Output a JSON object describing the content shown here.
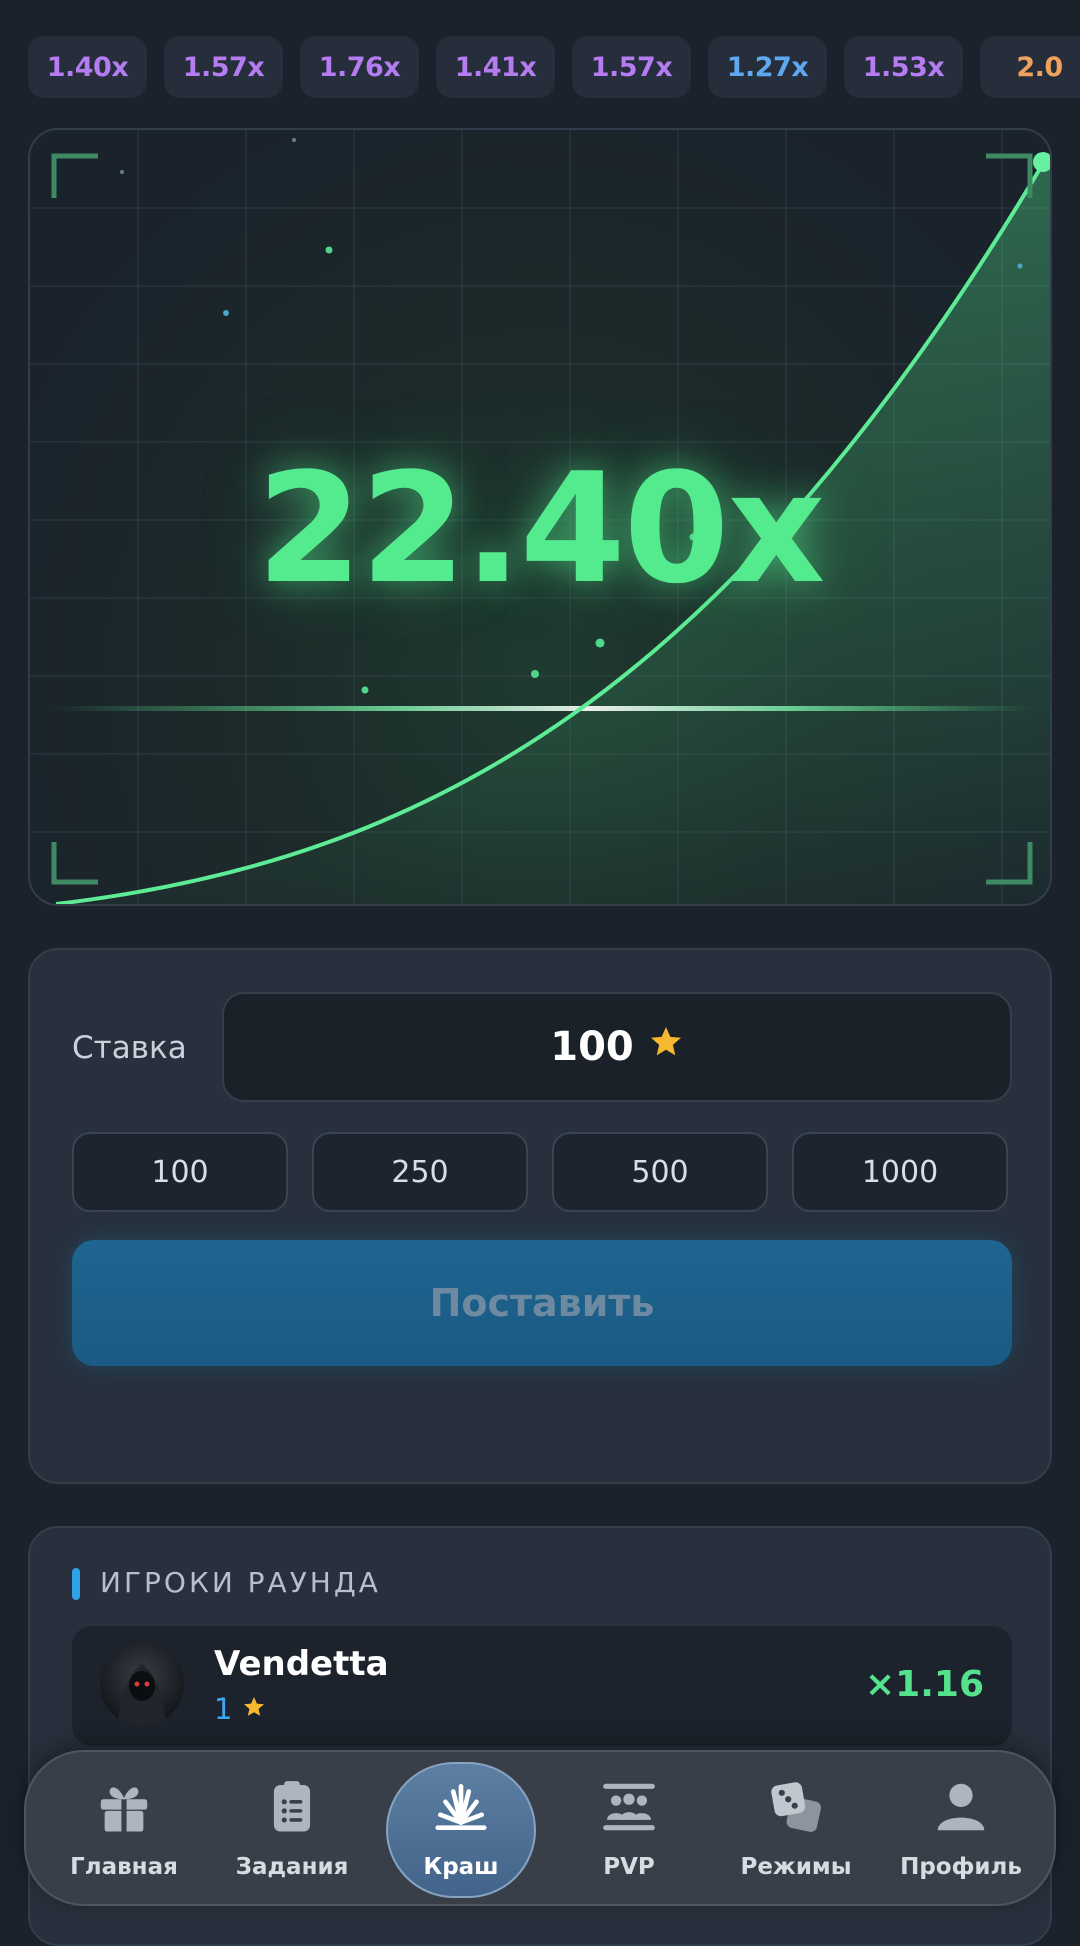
{
  "history": [
    {
      "label": "1.40x",
      "color": "#b57bf1"
    },
    {
      "label": "1.57x",
      "color": "#b57bf1"
    },
    {
      "label": "1.76x",
      "color": "#b57bf1"
    },
    {
      "label": "1.41x",
      "color": "#b57bf1"
    },
    {
      "label": "1.57x",
      "color": "#b57bf1"
    },
    {
      "label": "1.27x",
      "color": "#5fa8f0"
    },
    {
      "label": "1.53x",
      "color": "#b57bf1"
    },
    {
      "label": "2.0",
      "color": "#f0a15c"
    }
  ],
  "game": {
    "multiplier": "22.40x",
    "accent_color": "#54ea8e"
  },
  "bet": {
    "label": "Ставка",
    "amount": "100",
    "currency_icon": "star-icon",
    "quick_amounts": [
      "100",
      "250",
      "500",
      "1000"
    ],
    "place_label": "Поставить"
  },
  "players": {
    "title": "ИГРОКИ РАУНДА",
    "list": [
      {
        "name": "Vendetta",
        "bet": "1",
        "multiplier": "×1.16"
      }
    ]
  },
  "nav": {
    "items": [
      {
        "label": "Главная",
        "icon": "gift-icon"
      },
      {
        "label": "Задания",
        "icon": "clipboard-icon"
      },
      {
        "label": "Краш",
        "icon": "crash-icon"
      },
      {
        "label": "PVP",
        "icon": "pvp-icon"
      },
      {
        "label": "Режимы",
        "icon": "dice-icon"
      },
      {
        "label": "Профиль",
        "icon": "profile-icon"
      }
    ],
    "active": "Краш"
  }
}
